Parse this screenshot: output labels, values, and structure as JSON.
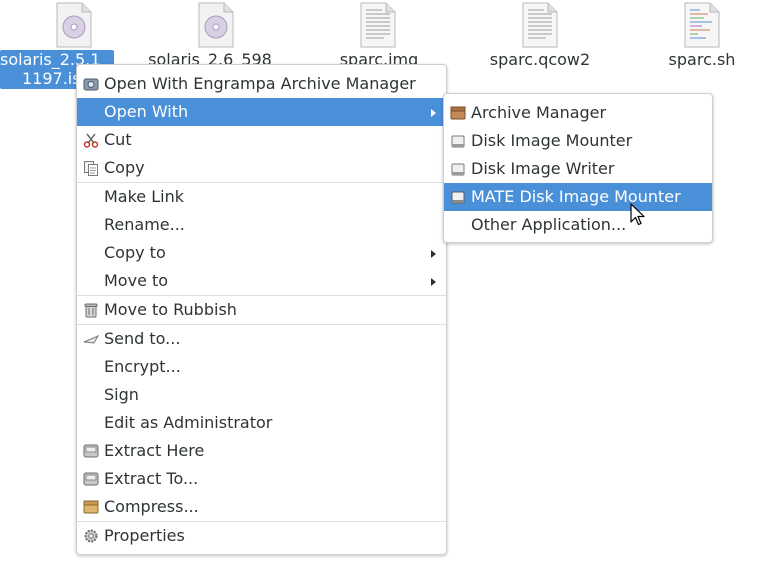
{
  "desktop": {
    "files": [
      {
        "name_line1": "solaris_2.5.1",
        "name_line2": "1197.iso",
        "icon": "disc-image-icon",
        "selected": true
      },
      {
        "name_line1": "solaris_2.6_598",
        "icon": "disc-image-icon"
      },
      {
        "name_line1": "sparc.img",
        "icon": "text-file-icon"
      },
      {
        "name_line1": "sparc.qcow2",
        "icon": "text-file-icon"
      },
      {
        "name_line1": "sparc.sh",
        "icon": "script-file-icon"
      }
    ]
  },
  "context_menu": {
    "open_with_engrampa": "Open With Engrampa Archive Manager",
    "open_with": "Open With",
    "cut": "Cut",
    "copy": "Copy",
    "make_link": "Make Link",
    "rename": "Rename...",
    "copy_to": "Copy to",
    "move_to": "Move to",
    "move_to_rubbish": "Move to Rubbish",
    "send_to": "Send to...",
    "encrypt": "Encrypt...",
    "sign": "Sign",
    "edit_as_admin": "Edit as Administrator",
    "extract_here": "Extract Here",
    "extract_to": "Extract To...",
    "compress": "Compress...",
    "properties": "Properties"
  },
  "open_with_submenu": {
    "archive_manager": "Archive Manager",
    "disk_image_mounter": "Disk Image Mounter",
    "disk_image_writer": "Disk Image Writer",
    "mate_disk_image_mounter": "MATE Disk Image Mounter",
    "other_application": "Other Application..."
  },
  "colors": {
    "highlight": "#4a90d9",
    "text": "#2e3436"
  }
}
